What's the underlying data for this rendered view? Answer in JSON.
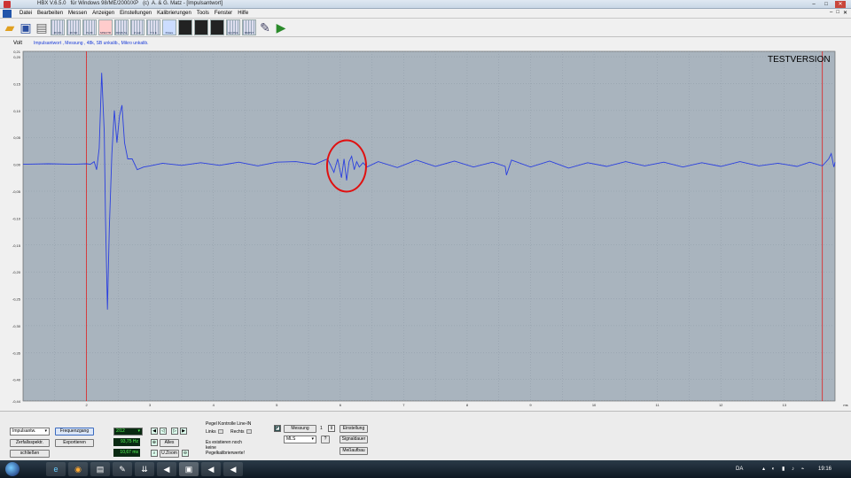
{
  "window": {
    "title": "HBX V.6.5.0   für Windows 98/ME/2000/XP   (c)  A. & G. Matz - [Impulsantwort]",
    "min_label": "–",
    "max_label": "□",
    "close_label": "✕"
  },
  "menu": {
    "items": [
      "Datei",
      "Bearbeiten",
      "Messen",
      "Anzeigen",
      "Einstellungen",
      "Kalibrierungen",
      "Tools",
      "Fenster",
      "Hilfe"
    ],
    "mdi_min": "–",
    "mdi_max": "□",
    "mdi_close": "✕"
  },
  "toolbar": {
    "open_icon": "folder-open-icon",
    "save_icon": "floppy-disk-icon",
    "print_icon": "printer-icon",
    "graph_labels": [
      "ZF DS",
      "ZF SD",
      "IS ZF",
      "SPECTR",
      "FRQS SL",
      "Z calc",
      "T S E",
      "Polare"
    ],
    "dark_labels": [
      "",
      "",
      ""
    ],
    "other_labels": [
      "EQ Pink",
      "MMPLT"
    ],
    "tool_icon": "wrench-icon",
    "exit_icon": "exit-door-icon"
  },
  "plot": {
    "unit_label": "Volt",
    "description": "Impulsantwort , Messung , 48k, SB unkalib., Mikro unkalib.",
    "watermark": "TESTVERSION",
    "bg_color": "#a9b4be",
    "trace_color": "#2a3fe0",
    "marker_color": "#e02020",
    "annotation_color": "#e01010",
    "x_unit_label": "ms"
  },
  "chart_data": {
    "type": "line",
    "title": "",
    "xlabel": "",
    "ylabel": "Volt",
    "xlim": [
      1.0,
      13.8
    ],
    "ylim": [
      -0.44,
      0.21
    ],
    "y_ticks": [
      0.21,
      0.2,
      0.15,
      0.1,
      0.05,
      0.0,
      -0.05,
      -0.1,
      -0.15,
      -0.2,
      -0.25,
      -0.3,
      -0.35,
      -0.4,
      -0.44
    ],
    "y_tick_labels": [
      "0,21",
      "0,20",
      "0,15",
      "0,10",
      "0,05",
      "0,00",
      "-0,05",
      "-0,10",
      "-0,15",
      "-0,20",
      "-0,25",
      "-0,30",
      "-0,35",
      "-0,40",
      "-0,44"
    ],
    "x_ticks": [
      2,
      3,
      4,
      5,
      6,
      7,
      8,
      9,
      10,
      11,
      12,
      13
    ],
    "x_tick_labels": [
      "2",
      "3",
      "4",
      "5",
      "6",
      "7",
      "8",
      "9",
      "10",
      "11",
      "12",
      "13"
    ],
    "markers_x": [
      2.0,
      13.6
    ],
    "grid": true,
    "legend": "none",
    "series": [
      {
        "x": [
          1.0,
          1.4,
          1.8,
          2.0,
          2.06,
          2.12,
          2.16,
          2.2,
          2.24,
          2.28,
          2.3,
          2.33,
          2.36,
          2.4,
          2.44,
          2.48,
          2.52,
          2.56,
          2.6,
          2.65,
          2.72,
          2.8,
          2.9,
          3.0,
          3.2,
          3.5,
          3.8,
          4.1,
          4.4,
          4.7,
          5.0,
          5.3,
          5.6,
          5.8,
          5.9,
          5.96,
          6.02,
          6.06,
          6.1,
          6.14,
          6.18,
          6.22,
          6.26,
          6.3,
          6.36,
          6.42,
          6.6,
          6.9,
          7.2,
          7.5,
          7.8,
          8.1,
          8.4,
          8.6,
          8.62,
          8.7,
          9.0,
          9.3,
          9.6,
          9.9,
          10.2,
          10.5,
          10.8,
          11.1,
          11.4,
          11.7,
          12.0,
          12.3,
          12.6,
          12.9,
          13.2,
          13.4,
          13.6,
          13.7,
          13.74,
          13.78,
          13.8
        ],
        "y": [
          0.0,
          0.001,
          0.0,
          0.001,
          0.0,
          0.005,
          -0.01,
          0.03,
          0.17,
          0.06,
          -0.1,
          -0.27,
          -0.12,
          0.02,
          0.1,
          0.04,
          0.09,
          0.11,
          0.04,
          0.01,
          0.01,
          -0.01,
          -0.005,
          -0.003,
          0.002,
          -0.002,
          0.003,
          -0.002,
          0.004,
          -0.003,
          0.004,
          0.005,
          0.0,
          0.01,
          -0.015,
          0.01,
          -0.025,
          0.01,
          -0.03,
          0.005,
          0.015,
          -0.01,
          0.005,
          -0.005,
          0.003,
          -0.005,
          0.005,
          -0.006,
          0.008,
          -0.004,
          0.006,
          -0.005,
          0.004,
          -0.004,
          -0.02,
          0.008,
          -0.005,
          0.006,
          -0.007,
          0.003,
          -0.004,
          0.005,
          -0.003,
          0.004,
          -0.005,
          0.003,
          -0.004,
          0.005,
          -0.003,
          0.002,
          -0.004,
          0.004,
          -0.003,
          0.01,
          0.02,
          -0.005,
          0.004
        ]
      }
    ]
  },
  "controls": {
    "view_select": "Impulsantw.",
    "decay_btn": "Zerfallsspektr.",
    "close_btn": "schließen",
    "freq_btn": "Frequenzgang",
    "export_btn": "Exportieren",
    "resolution_select": "2/12",
    "freq_readout": "93,75 Hz",
    "time_readout": "10,67 ms",
    "alles_btn": "Alles",
    "zoom_btn": "U.Zoom",
    "level_title": "Pegel Kontrolle Line-IN",
    "left_label": "Links",
    "right_label": "Rechts",
    "level_note": "Es existieren noch\nkeine\nPegelkalibrierwerte!",
    "measure_btn": "Messung",
    "measure_count": "1",
    "mls_select": "MLS",
    "help_btn": "?",
    "settings_btn": "Einstellung",
    "signal_btn": "Signaldauer",
    "setup_btn": "Meßaufbau"
  },
  "taskbar": {
    "lang": "DA",
    "tray_icons": "▴ ◐ ▮ ♪ ⌁",
    "clock": "19:16",
    "apps": [
      "e",
      "◉",
      "▤",
      "✎",
      "⇊",
      "◀",
      "▣",
      "◀",
      "◀"
    ]
  }
}
